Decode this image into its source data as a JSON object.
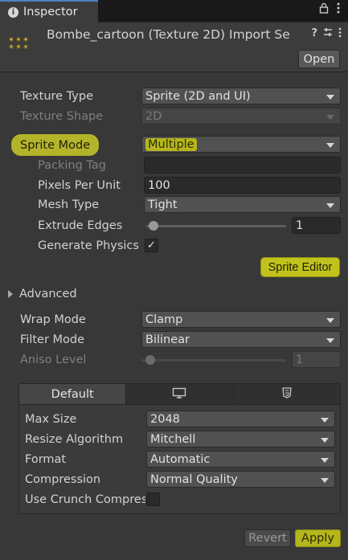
{
  "tab": {
    "title": "Inspector",
    "lock_icon": "lock-icon",
    "menu_icon": "kebab-menu-icon"
  },
  "header": {
    "asset_title": "Bombe_cartoon (Texture 2D) Import Se",
    "help_icon": "?",
    "open_label": "Open"
  },
  "fields": {
    "texture_type": {
      "label": "Texture Type",
      "value": "Sprite (2D and UI)"
    },
    "texture_shape": {
      "label": "Texture Shape",
      "value": "2D"
    },
    "sprite_mode": {
      "label": "Sprite Mode",
      "value": "Multiple"
    },
    "packing_tag": {
      "label": "Packing Tag",
      "value": ""
    },
    "pixels_per_unit": {
      "label": "Pixels Per Unit",
      "value": "100"
    },
    "mesh_type": {
      "label": "Mesh Type",
      "value": "Tight"
    },
    "extrude_edges": {
      "label": "Extrude Edges",
      "value": "1",
      "level": 0.05
    },
    "generate_physics": {
      "label": "Generate Physics",
      "checked": true,
      "check_glyph": "✓"
    },
    "sprite_editor_label": "Sprite Editor",
    "advanced_label": "Advanced",
    "wrap_mode": {
      "label": "Wrap Mode",
      "value": "Clamp"
    },
    "filter_mode": {
      "label": "Filter Mode",
      "value": "Bilinear"
    },
    "aniso_level": {
      "label": "Aniso Level",
      "value": "1",
      "level": 0.06
    }
  },
  "platform": {
    "tabs": [
      {
        "label": "Default",
        "icon": ""
      },
      {
        "label": "",
        "icon": "monitor-icon"
      },
      {
        "label": "",
        "icon": "html5-icon"
      }
    ],
    "max_size": {
      "label": "Max Size",
      "value": "2048"
    },
    "resize_algorithm": {
      "label": "Resize Algorithm",
      "value": "Mitchell"
    },
    "format": {
      "label": "Format",
      "value": "Automatic"
    },
    "compression": {
      "label": "Compression",
      "value": "Normal Quality"
    },
    "use_crunch": {
      "label": "Use Crunch Compres",
      "checked": false
    }
  },
  "footer": {
    "revert_label": "Revert",
    "apply_label": "Apply"
  },
  "colors": {
    "highlight": "#c2c21c",
    "panel": "#383838",
    "field": "#515151",
    "accent_tab": "#4e80c4"
  }
}
